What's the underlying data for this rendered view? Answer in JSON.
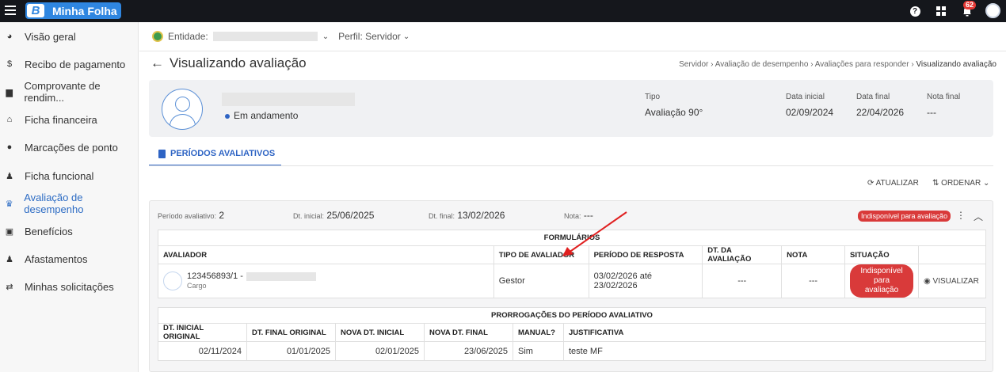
{
  "app": {
    "name": "Minha Folha",
    "logo_letter": "B",
    "notifications": "62"
  },
  "sidebar": {
    "items": [
      {
        "label": "Visão geral",
        "icon": "pie-chart-icon"
      },
      {
        "label": "Recibo de pagamento",
        "icon": "dollar-icon"
      },
      {
        "label": "Comprovante de rendim...",
        "icon": "document-icon"
      },
      {
        "label": "Ficha financeira",
        "icon": "bank-icon"
      },
      {
        "label": "Marcações de ponto",
        "icon": "clock-icon"
      },
      {
        "label": "Ficha funcional",
        "icon": "user-icon"
      },
      {
        "label": "Avaliação de desempenho",
        "icon": "trophy-icon"
      },
      {
        "label": "Benefícios",
        "icon": "gift-icon"
      },
      {
        "label": "Afastamentos",
        "icon": "user-x-icon"
      },
      {
        "label": "Minhas solicitações",
        "icon": "swap-icon"
      }
    ],
    "active_index": 6
  },
  "context": {
    "entity_label": "Entidade:",
    "profile_label": "Perfil: Servidor"
  },
  "page": {
    "title": "Visualizando avaliação",
    "breadcrumb": [
      "Servidor",
      "Avaliação de desempenho",
      "Avaliações para responder",
      "Visualizando avaliação"
    ]
  },
  "profile": {
    "status": "Em andamento",
    "tipo_label": "Tipo",
    "tipo_value": "Avaliação 90°",
    "data_inicial_label": "Data inicial",
    "data_inicial_value": "02/09/2024",
    "data_final_label": "Data final",
    "data_final_value": "22/04/2026",
    "nota_final_label": "Nota final",
    "nota_final_value": "---"
  },
  "tab": {
    "label": "PERÍODOS AVALIATIVOS"
  },
  "actions": {
    "refresh": "ATUALIZAR",
    "sort": "ORDENAR"
  },
  "period": {
    "periodo_label": "Período avaliativo:",
    "periodo_value": "2",
    "dt_inicial_label": "Dt. inicial:",
    "dt_inicial_value": "25/06/2025",
    "dt_final_label": "Dt. final:",
    "dt_final_value": "13/02/2026",
    "nota_label": "Nota:",
    "nota_value": "---",
    "status": "Indisponível para avaliação"
  },
  "forms_table": {
    "caption": "FORMULÁRIOS",
    "headers": [
      "AVALIADOR",
      "TIPO DE AVALIADOR",
      "PERÍODO DE RESPOSTA",
      "DT. DA AVALIAÇÃO",
      "NOTA",
      "SITUAÇÃO",
      ""
    ],
    "row": {
      "evaluator_id": "123456893/1 -",
      "evaluator_role": "Cargo",
      "tipo": "Gestor",
      "periodo": "03/02/2026 até 23/02/2026",
      "dt_avaliacao": "---",
      "nota": "---",
      "situacao": "Indisponível para avaliação",
      "action": "VISUALIZAR"
    }
  },
  "extensions_table": {
    "caption": "PRORROGAÇÕES DO PERÍODO AVALIATIVO",
    "headers": [
      "DT. INICIAL ORIGINAL",
      "DT. FINAL ORIGINAL",
      "NOVA DT. INICIAL",
      "NOVA DT. FINAL",
      "MANUAL?",
      "JUSTIFICATIVA"
    ],
    "rows": [
      [
        "02/11/2024",
        "01/01/2025",
        "02/01/2025",
        "23/06/2025",
        "Sim",
        "teste MF"
      ]
    ]
  },
  "colors": {
    "brand": "#2f86e0",
    "accent": "#2e64c4",
    "danger": "#d93a3a",
    "topbar": "#15171c"
  }
}
